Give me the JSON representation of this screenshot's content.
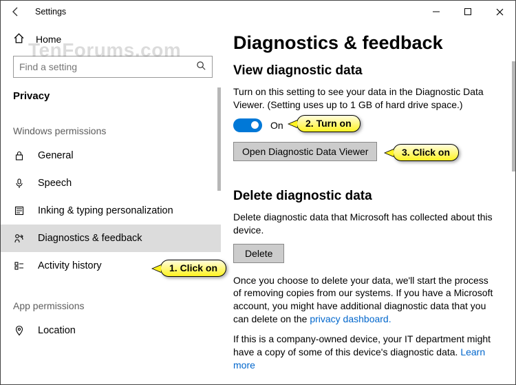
{
  "titlebar": {
    "title": "Settings"
  },
  "watermark": "TenForums.com",
  "sidebar": {
    "home": "Home",
    "search_placeholder": "Find a setting",
    "crumb": "Privacy",
    "section1": "Windows permissions",
    "items": [
      {
        "label": "General"
      },
      {
        "label": "Speech"
      },
      {
        "label": "Inking & typing personalization"
      },
      {
        "label": "Diagnostics & feedback"
      },
      {
        "label": "Activity history"
      }
    ],
    "section2": "App permissions",
    "items2": [
      {
        "label": "Location"
      }
    ]
  },
  "content": {
    "h1": "Diagnostics & feedback",
    "view": {
      "h2": "View diagnostic data",
      "desc": "Turn on this setting to see your data in the Diagnostic Data Viewer. (Setting uses up to 1 GB of hard drive space.)",
      "toggle_state": "On",
      "open_btn": "Open Diagnostic Data Viewer"
    },
    "del": {
      "h2": "Delete diagnostic data",
      "desc": "Delete diagnostic data that Microsoft has collected about this device.",
      "btn": "Delete",
      "after1": "Once you choose to delete your data, we'll start the process of removing copies from our systems. If you have a Microsoft account, you might have additional diagnostic data that you can delete on the ",
      "link1": "privacy dashboard.",
      "after2a": "If this is a company-owned device, your IT department might have a copy of some of this device's diagnostic data. ",
      "link2": "Learn more"
    }
  },
  "callouts": {
    "c1": "1. Click on",
    "c2": "2. Turn on",
    "c3": "3. Click on"
  }
}
